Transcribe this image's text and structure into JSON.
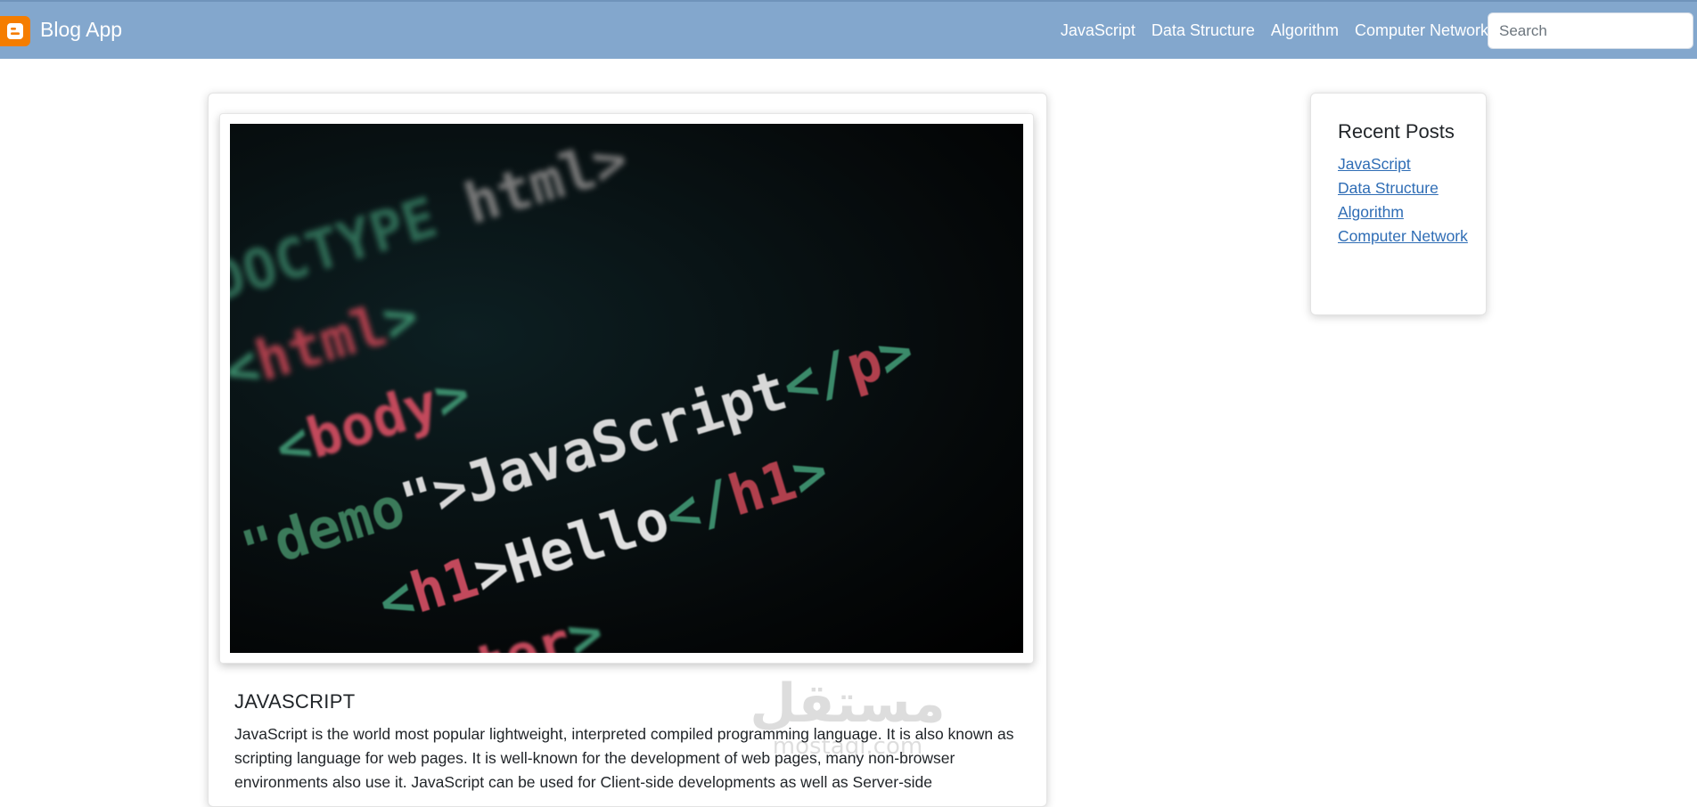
{
  "navbar": {
    "brand": "Blog App",
    "brand_icon": "blogger-icon",
    "links": [
      "JavaScript",
      "Data Structure",
      "Algorithm",
      "Computer Network"
    ],
    "search_placeholder": "Search",
    "background": "#83a7cd"
  },
  "post": {
    "image_icon": "code-screen-image",
    "image_code_lines": [
      "<!DOCTYPE html>",
      "<html>",
      "<body>",
      "\"demo\">JavaScript</p>",
      "<h1>Hello</h1>",
      "<center>"
    ],
    "title": "JAVASCRIPT",
    "body": "JavaScript is the world most popular lightweight, interpreted compiled programming language. It is also known as scripting language for web pages. It is well-known for the development of web pages, many non-browser environments also use it. JavaScript can be used for Client-side developments as well as Server-side"
  },
  "sidebar": {
    "title": "Recent Posts",
    "links": [
      "JavaScript",
      "Data Structure",
      "Algorithm",
      "Computer Network"
    ]
  },
  "watermark": {
    "text_arabic": "مستقل",
    "text_latin": "mostaql.com"
  },
  "colors": {
    "link": "#2f6db5",
    "brand_icon": "#f57d00"
  }
}
